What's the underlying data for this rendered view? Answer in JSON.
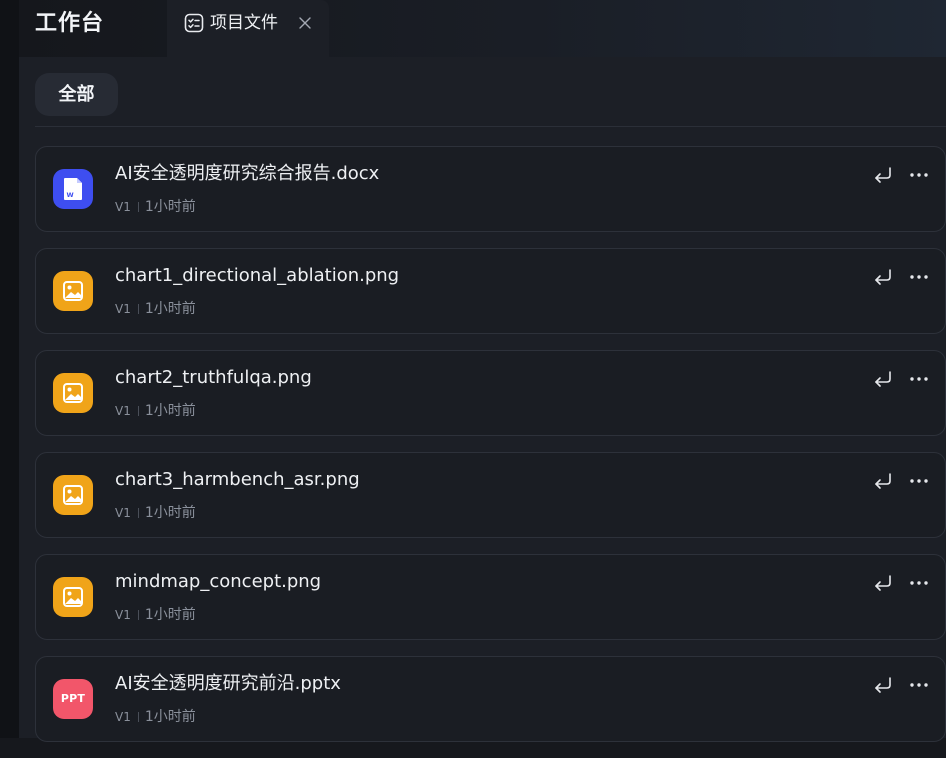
{
  "header": {
    "app_title": "工作台",
    "tab": {
      "label": "项目文件",
      "icon": "checklist-icon",
      "close_icon": "close-icon"
    }
  },
  "filter": {
    "active_label": "全部"
  },
  "files": [
    {
      "name": "AI安全透明度研究综合报告.docx",
      "type": "word",
      "icon": "word-doc-icon",
      "version": "V1",
      "time": "1小时前"
    },
    {
      "name": "chart1_directional_ablation.png",
      "type": "image",
      "icon": "image-file-icon",
      "version": "V1",
      "time": "1小时前"
    },
    {
      "name": "chart2_truthfulqa.png",
      "type": "image",
      "icon": "image-file-icon",
      "version": "V1",
      "time": "1小时前"
    },
    {
      "name": "chart3_harmbench_asr.png",
      "type": "image",
      "icon": "image-file-icon",
      "version": "V1",
      "time": "1小时前"
    },
    {
      "name": "mindmap_concept.png",
      "type": "image",
      "icon": "image-file-icon",
      "version": "V1",
      "time": "1小时前"
    },
    {
      "name": "AI安全透明度研究前沿.pptx",
      "type": "ppt",
      "icon": "ppt-file-icon",
      "icon_text": "PPT",
      "version": "V1",
      "time": "1小时前"
    }
  ],
  "colors": {
    "word": "#3e4ef0",
    "image": "#f0a419",
    "ppt": "#f2566a",
    "background": "#1c1f26"
  }
}
